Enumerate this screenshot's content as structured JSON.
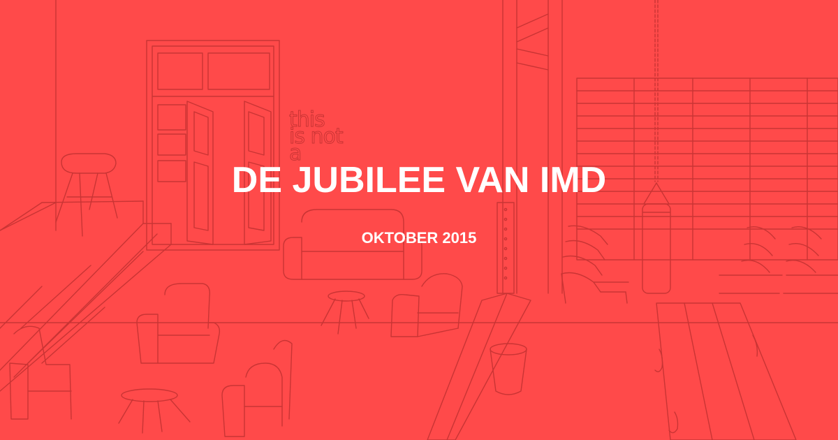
{
  "banner": {
    "title": "DE JUBILEE VAN IMD",
    "subtitle": "OKTOBER 2015",
    "wall_text": "this\nis not\na",
    "background_color": "#FF4A4A",
    "line_color": "#C93434",
    "text_color": "#FFFFFF"
  },
  "scene_icons": [
    "interior-line-drawing",
    "double-door-icon",
    "pommel-horse-icon",
    "wall-bars-icon",
    "punching-bag-icon",
    "sofa-icon",
    "armchair-icon",
    "stool-icon",
    "gym-bench-icon",
    "bucket-icon",
    "table-icon"
  ]
}
